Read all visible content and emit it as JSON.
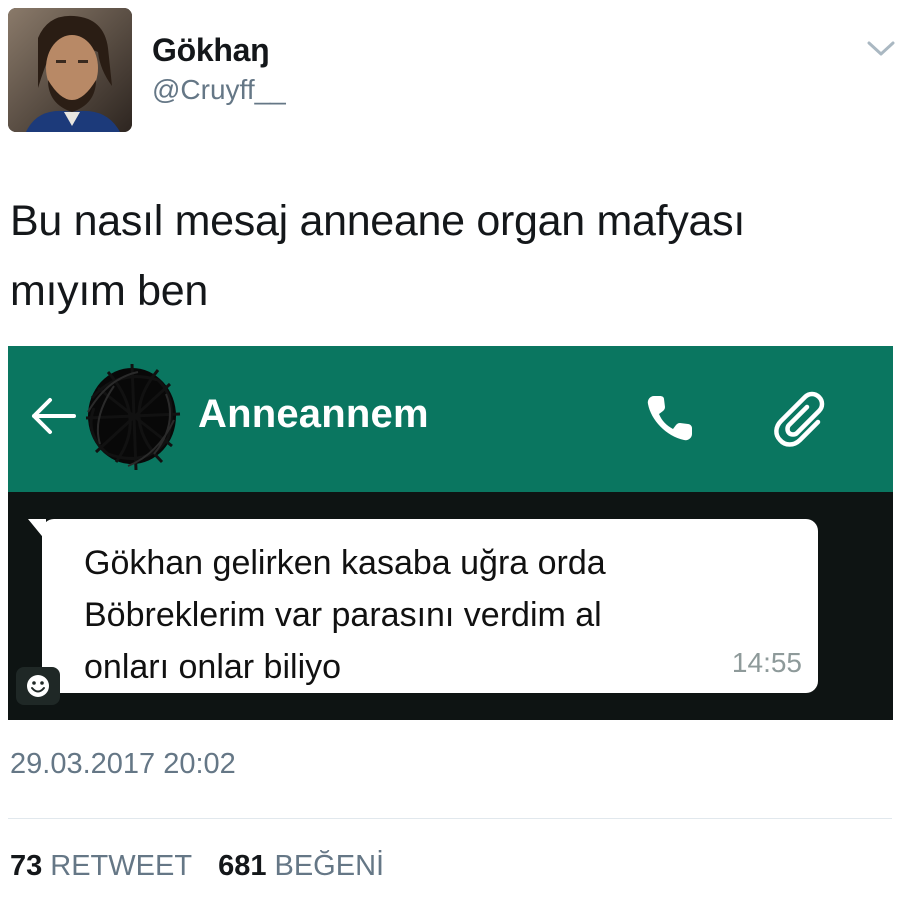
{
  "tweet": {
    "author": {
      "name": "Gökhaŋ",
      "handle": "@Cruyff__",
      "avatar": "profile-photo"
    },
    "menu_icon": "chevron-down-icon",
    "text_line1": "Bu nasıl mesaj anneane organ mafyası",
    "text_line2": "mıyım ben",
    "timestamp": "29.03.2017 20:02",
    "stats": {
      "retweets_count": "73",
      "retweets_label": "RETWEET",
      "likes_count": "681",
      "likes_label": "BEĞENİ"
    }
  },
  "embedded_chat": {
    "app": "whatsapp",
    "header_color": "#0a7660",
    "contact_name": "Anneannem",
    "back_icon": "arrow-left-icon",
    "contact_avatar": "scribbled-out-avatar",
    "call_icon": "phone-icon",
    "attach_icon": "paperclip-icon",
    "message": {
      "line1": "Gökhan gelirken kasaba  uğra orda",
      "line2": "Böbreklerim var parasını verdim al",
      "line3": "onları onlar biliyo",
      "time": "14:55"
    },
    "emoji_icon": "smiley-icon"
  },
  "colors": {
    "text_primary": "#14171a",
    "text_secondary": "#657786",
    "chat_background": "#0e1413"
  }
}
